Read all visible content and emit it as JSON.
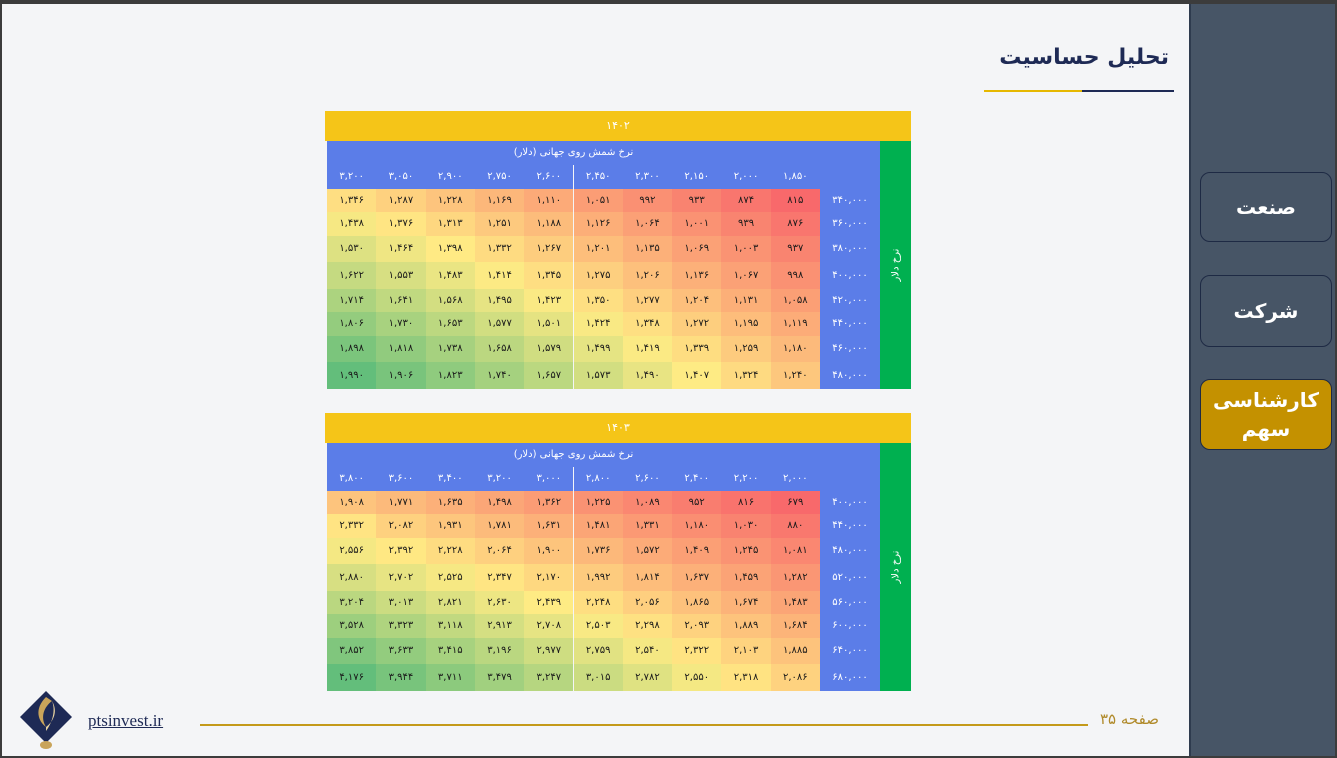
{
  "title": "تحلیل حساسیت",
  "sidebar": {
    "items": [
      {
        "label": "صنعت",
        "active": false
      },
      {
        "label": "شرکت",
        "active": false
      },
      {
        "label": "کارشناسی سهم",
        "active": true
      }
    ]
  },
  "tables": [
    {
      "year": "۱۴۰۲",
      "col_title": "نرخ شمش روی جهانی (دلار)",
      "row_title": "نرخ دلار",
      "columns": [
        "۳,۲۰۰",
        "۳,۰۵۰",
        "۲,۹۰۰",
        "۲,۷۵۰",
        "۲,۶۰۰",
        "۲,۴۵۰",
        "۲,۳۰۰",
        "۲,۱۵۰",
        "۲,۰۰۰",
        "۱,۸۵۰"
      ],
      "rows": [
        {
          "label": "۳۴۰,۰۰۰",
          "values": [
            "۱,۳۴۶",
            "۱,۲۸۷",
            "۱,۲۲۸",
            "۱,۱۶۹",
            "۱,۱۱۰",
            "۱,۰۵۱",
            "۹۹۲",
            "۹۳۳",
            "۸۷۴",
            "۸۱۵"
          ]
        },
        {
          "label": "۳۶۰,۰۰۰",
          "values": [
            "۱,۴۳۸",
            "۱,۳۷۶",
            "۱,۳۱۳",
            "۱,۲۵۱",
            "۱,۱۸۸",
            "۱,۱۲۶",
            "۱,۰۶۴",
            "۱,۰۰۱",
            "۹۳۹",
            "۸۷۶"
          ]
        },
        {
          "label": "۳۸۰,۰۰۰",
          "values": [
            "۱,۵۳۰",
            "۱,۴۶۴",
            "۱,۳۹۸",
            "۱,۳۳۲",
            "۱,۲۶۷",
            "۱,۲۰۱",
            "۱,۱۳۵",
            "۱,۰۶۹",
            "۱,۰۰۳",
            "۹۳۷"
          ]
        },
        {
          "label": "۴۰۰,۰۰۰",
          "values": [
            "۱,۶۲۲",
            "۱,۵۵۳",
            "۱,۴۸۳",
            "۱,۴۱۴",
            "۱,۳۴۵",
            "۱,۲۷۵",
            "۱,۲۰۶",
            "۱,۱۳۶",
            "۱,۰۶۷",
            "۹۹۸"
          ]
        },
        {
          "label": "۴۲۰,۰۰۰",
          "values": [
            "۱,۷۱۴",
            "۱,۶۴۱",
            "۱,۵۶۸",
            "۱,۴۹۵",
            "۱,۴۲۳",
            "۱,۳۵۰",
            "۱,۲۷۷",
            "۱,۲۰۴",
            "۱,۱۳۱",
            "۱,۰۵۸"
          ]
        },
        {
          "label": "۴۴۰,۰۰۰",
          "values": [
            "۱,۸۰۶",
            "۱,۷۳۰",
            "۱,۶۵۳",
            "۱,۵۷۷",
            "۱,۵۰۱",
            "۱,۴۲۴",
            "۱,۳۴۸",
            "۱,۲۷۲",
            "۱,۱۹۵",
            "۱,۱۱۹"
          ]
        },
        {
          "label": "۴۶۰,۰۰۰",
          "values": [
            "۱,۸۹۸",
            "۱,۸۱۸",
            "۱,۷۳۸",
            "۱,۶۵۸",
            "۱,۵۷۹",
            "۱,۴۹۹",
            "۱,۴۱۹",
            "۱,۳۳۹",
            "۱,۲۵۹",
            "۱,۱۸۰"
          ]
        },
        {
          "label": "۴۸۰,۰۰۰",
          "values": [
            "۱,۹۹۰",
            "۱,۹۰۶",
            "۱,۸۲۳",
            "۱,۷۴۰",
            "۱,۶۵۷",
            "۱,۵۷۳",
            "۱,۴۹۰",
            "۱,۴۰۷",
            "۱,۳۲۴",
            "۱,۲۴۰"
          ]
        }
      ]
    },
    {
      "year": "۱۴۰۳",
      "col_title": "نرخ شمش روی جهانی (دلار)",
      "row_title": "نرخ دلار",
      "columns": [
        "۳,۸۰۰",
        "۳,۶۰۰",
        "۳,۴۰۰",
        "۳,۲۰۰",
        "۳,۰۰۰",
        "۲,۸۰۰",
        "۲,۶۰۰",
        "۲,۴۰۰",
        "۲,۲۰۰",
        "۲,۰۰۰"
      ],
      "rows": [
        {
          "label": "۴۰۰,۰۰۰",
          "values": [
            "۱,۹۰۸",
            "۱,۷۷۱",
            "۱,۶۳۵",
            "۱,۴۹۸",
            "۱,۳۶۲",
            "۱,۲۲۵",
            "۱,۰۸۹",
            "۹۵۲",
            "۸۱۶",
            "۶۷۹"
          ]
        },
        {
          "label": "۴۴۰,۰۰۰",
          "values": [
            "۲,۳۳۲",
            "۲,۰۸۲",
            "۱,۹۳۱",
            "۱,۷۸۱",
            "۱,۶۳۱",
            "۱,۴۸۱",
            "۱,۳۳۱",
            "۱,۱۸۰",
            "۱,۰۳۰",
            "۸۸۰"
          ]
        },
        {
          "label": "۴۸۰,۰۰۰",
          "values": [
            "۲,۵۵۶",
            "۲,۳۹۲",
            "۲,۲۲۸",
            "۲,۰۶۴",
            "۱,۹۰۰",
            "۱,۷۳۶",
            "۱,۵۷۲",
            "۱,۴۰۹",
            "۱,۲۴۵",
            "۱,۰۸۱"
          ]
        },
        {
          "label": "۵۲۰,۰۰۰",
          "values": [
            "۲,۸۸۰",
            "۲,۷۰۲",
            "۲,۵۲۵",
            "۲,۳۴۷",
            "۲,۱۷۰",
            "۱,۹۹۲",
            "۱,۸۱۴",
            "۱,۶۳۷",
            "۱,۴۵۹",
            "۱,۲۸۲"
          ]
        },
        {
          "label": "۵۶۰,۰۰۰",
          "values": [
            "۳,۲۰۴",
            "۳,۰۱۳",
            "۲,۸۲۱",
            "۲,۶۳۰",
            "۲,۴۳۹",
            "۲,۲۴۸",
            "۲,۰۵۶",
            "۱,۸۶۵",
            "۱,۶۷۴",
            "۱,۴۸۳"
          ]
        },
        {
          "label": "۶۰۰,۰۰۰",
          "values": [
            "۳,۵۲۸",
            "۳,۳۲۳",
            "۳,۱۱۸",
            "۲,۹۱۳",
            "۲,۷۰۸",
            "۲,۵۰۳",
            "۲,۲۹۸",
            "۲,۰۹۳",
            "۱,۸۸۹",
            "۱,۶۸۴"
          ]
        },
        {
          "label": "۶۴۰,۰۰۰",
          "values": [
            "۳,۸۵۲",
            "۳,۶۳۳",
            "۳,۴۱۵",
            "۳,۱۹۶",
            "۲,۹۷۷",
            "۲,۷۵۹",
            "۲,۵۴۰",
            "۲,۳۲۲",
            "۲,۱۰۳",
            "۱,۸۸۵"
          ]
        },
        {
          "label": "۶۸۰,۰۰۰",
          "values": [
            "۴,۱۷۶",
            "۳,۹۴۴",
            "۳,۷۱۱",
            "۳,۴۷۹",
            "۳,۲۴۷",
            "۳,۰۱۵",
            "۲,۷۸۲",
            "۲,۵۵۰",
            "۲,۳۱۸",
            "۲,۰۸۶"
          ]
        }
      ]
    }
  ],
  "footer": {
    "site": "ptsinvest.ir",
    "page": "صفحه ۳۵"
  },
  "colors": {
    "sidebar_bg": "#475566",
    "active_button": "#c49100",
    "year_bar": "#f5c518",
    "header_blue": "#5b7de8",
    "row_title_green": "#00b050",
    "title_navy": "#1e2a55",
    "heat_low": "#f8696b",
    "heat_mid": "#ffeb84",
    "heat_high": "#63be7b"
  }
}
